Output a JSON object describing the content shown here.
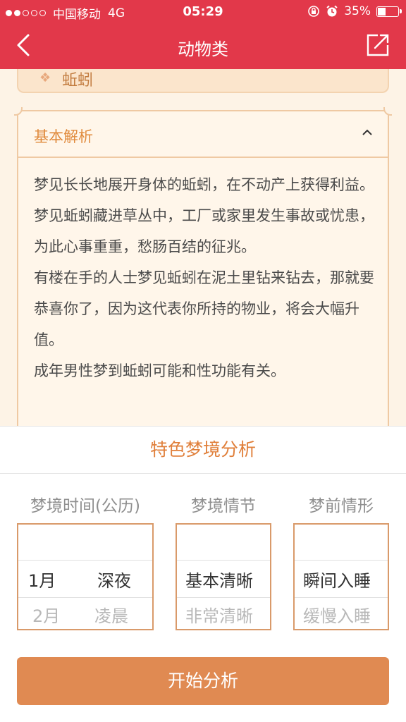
{
  "status_bar": {
    "carrier": "中国移动",
    "network": "4G",
    "time": "05:29",
    "battery_percent": "35%"
  },
  "nav": {
    "title": "动物类",
    "back_icon": "chevron-left-icon",
    "share_icon": "share-icon"
  },
  "subject": {
    "name": "蚯蚓"
  },
  "analysis": {
    "header": "基本解析",
    "paragraphs": [
      "梦见长长地展开身体的蚯蚓，在不动产上获得利益。",
      "梦见蚯蚓藏进草丛中，工厂或家里发生事故或忧患，为此心事重重，愁肠百结的征兆。",
      "有楼在手的人士梦见蚯蚓在泥土里钻来钻去，那就要恭喜你了，因为这代表你所持的物业，将会大幅升值。",
      "成年男性梦到蚯蚓可能和性功能有关。"
    ]
  },
  "dream_analysis": {
    "title": "特色梦境分析",
    "time": {
      "label": "梦境时间(公历)",
      "month_selected": "1月",
      "month_next": "2月",
      "period_selected": "深夜",
      "period_next": "凌晨"
    },
    "plot": {
      "label": "梦境情节",
      "selected": "基本清晰",
      "next": "非常清晰"
    },
    "before": {
      "label": "梦前情形",
      "selected": "瞬间入睡",
      "next": "缓慢入睡"
    },
    "start_button": "开始分析"
  },
  "colors": {
    "nav_bg": "#e2384a",
    "accent": "#e08a52",
    "card_border": "#efc9a3"
  }
}
